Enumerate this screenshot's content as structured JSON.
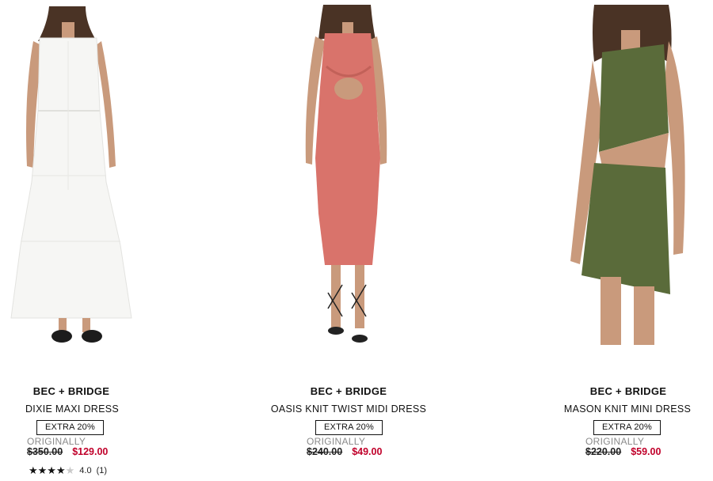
{
  "products": [
    {
      "brand": "BEC + BRIDGE",
      "name": "DIXIE MAXI DRESS",
      "badge": "EXTRA 20%",
      "originally_label": "ORIGINALLY",
      "original_price": "$350.00",
      "sale_price": "$129.00",
      "rating": {
        "stars_filled": 4,
        "stars_total": 5,
        "value": "4.0",
        "count": "(1)"
      },
      "dress_color": "#f6f6f4"
    },
    {
      "brand": "BEC + BRIDGE",
      "name": "OASIS KNIT TWIST MIDI DRESS",
      "badge": "EXTRA 20%",
      "originally_label": "ORIGINALLY",
      "original_price": "$240.00",
      "sale_price": "$49.00",
      "dress_color": "#d9736b"
    },
    {
      "brand": "BEC + BRIDGE",
      "name": "MASON KNIT MINI DRESS",
      "badge": "EXTRA 20%",
      "originally_label": "ORIGINALLY",
      "original_price": "$220.00",
      "sale_price": "$59.00",
      "dress_color": "#5a6b3a"
    }
  ],
  "colors": {
    "sale": "#c0002a",
    "muted": "#8a8a8a",
    "skin": "#c99a7c",
    "hair": "#4a3325"
  }
}
